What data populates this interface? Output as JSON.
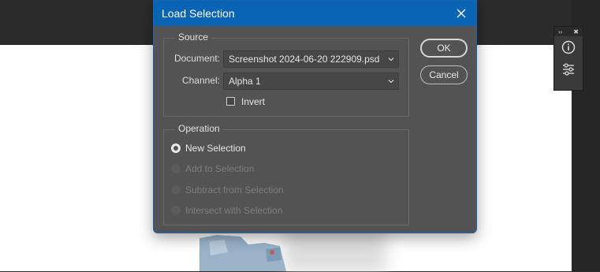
{
  "dialog": {
    "title": "Load Selection",
    "source": {
      "legend": "Source",
      "document_label": "Document:",
      "document_value": "Screenshot 2024-06-20 222909.psd",
      "channel_label": "Channel:",
      "channel_value": "Alpha 1",
      "invert_label": "Invert",
      "invert_checked": false
    },
    "operation": {
      "legend": "Operation",
      "options": [
        {
          "label": "New Selection",
          "selected": true,
          "enabled": true
        },
        {
          "label": "Add to Selection",
          "selected": false,
          "enabled": false
        },
        {
          "label": "Subtract from Selection",
          "selected": false,
          "enabled": false
        },
        {
          "label": "Intersect with Selection",
          "selected": false,
          "enabled": false
        }
      ]
    },
    "buttons": {
      "ok": "OK",
      "cancel": "Cancel"
    }
  },
  "side_panel": {
    "icons": [
      "info-icon",
      "adjustments-icon"
    ]
  },
  "colors": {
    "title_bar": "#0a64b6",
    "dialog_bg": "#535353",
    "canvas": "#ffffff",
    "workspace": "#2b2b2b"
  }
}
